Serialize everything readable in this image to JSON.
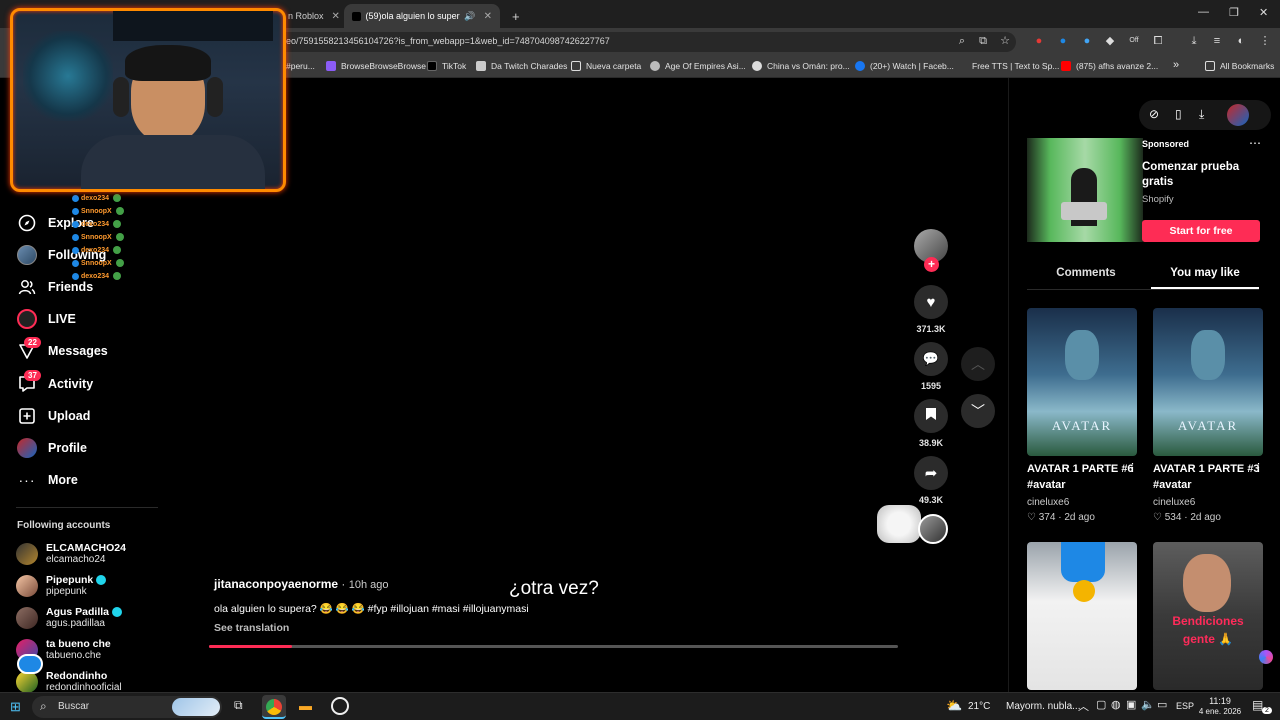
{
  "browser": {
    "tabs": [
      {
        "title": "n Roblox",
        "active": false
      },
      {
        "title": "(59)ola alguien lo supera? 😂",
        "active": true
      }
    ],
    "new_tab": "+",
    "url": "eo/7591558213456104726?is_from_webapp=1&web_id=7487040987426227767",
    "bookmarks": [
      "#peru...",
      "BrowseBrowseBrowse",
      "TikTok",
      "Da Twitch Charades",
      "Nueva carpeta",
      "Age Of Empires Asi...",
      "China vs Omán: pro...",
      "(20+) Watch | Faceb...",
      "Free TTS | Text to Sp...",
      "(875) afhs avanze 2...",
      "»",
      "All Bookmarks"
    ],
    "toolbar_extra": "Off"
  },
  "nav": {
    "items": [
      {
        "label": "Explore",
        "icon": "compass-icon"
      },
      {
        "label": "Following",
        "icon": "avatar-icon"
      },
      {
        "label": "Friends",
        "icon": "friends-icon"
      },
      {
        "label": "LIVE",
        "icon": "live-icon"
      },
      {
        "label": "Messages",
        "icon": "messages-icon",
        "badge": "22"
      },
      {
        "label": "Activity",
        "icon": "activity-icon",
        "badge": "37"
      },
      {
        "label": "Upload",
        "icon": "upload-icon"
      },
      {
        "label": "Profile",
        "icon": "profile-icon"
      },
      {
        "label": "More",
        "icon": "more-icon"
      }
    ],
    "following_header": "Following accounts",
    "accounts": [
      {
        "name": "ELCAMACHO24",
        "handle": "elcamacho24",
        "verified": false
      },
      {
        "name": "Pipepunk",
        "handle": "pipepunk",
        "verified": true
      },
      {
        "name": "Agus Padilla",
        "handle": "agus.padillaa",
        "verified": true
      },
      {
        "name": "ta bueno che",
        "handle": "tabueno.che",
        "verified": false
      },
      {
        "name": "Redondinho",
        "handle": "redondinhooficial",
        "verified": false
      }
    ]
  },
  "stream_chat": [
    {
      "user": "dexo234",
      "color": "#ff9a2e"
    },
    {
      "user": "SnnoopX",
      "color": "#ff9a2e"
    },
    {
      "user": "dexo234",
      "color": "#ff9a2e"
    },
    {
      "user": "SnnoopX",
      "color": "#ff9a2e"
    },
    {
      "user": "dexo234",
      "color": "#ff9a2e"
    },
    {
      "user": "SnnoopX",
      "color": "#ff9a2e"
    },
    {
      "user": "dexo234",
      "color": "#ff9a2e"
    }
  ],
  "video": {
    "author": "jitanaconpoyaenorme",
    "time_ago": "10h ago",
    "overlay_text": "¿otra vez?",
    "caption": "ola alguien lo supera? 😂 😂 😂 #fyp #illojuan #masi #illojuanymasi",
    "see_translation": "See translation",
    "progress_percent": 12,
    "likes": "371.3K",
    "comments": "1595",
    "saves": "38.9K",
    "shares": "49.3K",
    "follow_plus": "+"
  },
  "right": {
    "sponsored_label": "Sponsored",
    "ad_title": "Comenzar prueba gratis",
    "ad_brand": "Shopify",
    "ad_cta": "Start for free",
    "tabs": [
      "Comments",
      "You may like"
    ],
    "active_tab": 1,
    "cards": [
      {
        "title": "AVATAR 1 PARTE #6 #avatar",
        "user": "cineluxe6",
        "likes": "374",
        "date": "2d ago",
        "poster_text": "AVATAR"
      },
      {
        "title": "AVATAR 1 PARTE #3 #avatar",
        "user": "cineluxe6",
        "likes": "534",
        "date": "2d ago",
        "poster_text": "AVATAR"
      }
    ],
    "bottom_card_text": "Bendiciones gente 🙏"
  },
  "taskbar": {
    "search_placeholder": "Buscar",
    "weather_temp": "21°C",
    "weather_desc": "Mayorm. nubla...",
    "lang": "ESP",
    "time": "11:19",
    "date": "4 ene. 2026",
    "notif_count": "2"
  },
  "colors": {
    "accent": "#fe2c55",
    "cam_border": "#ff8a00"
  }
}
